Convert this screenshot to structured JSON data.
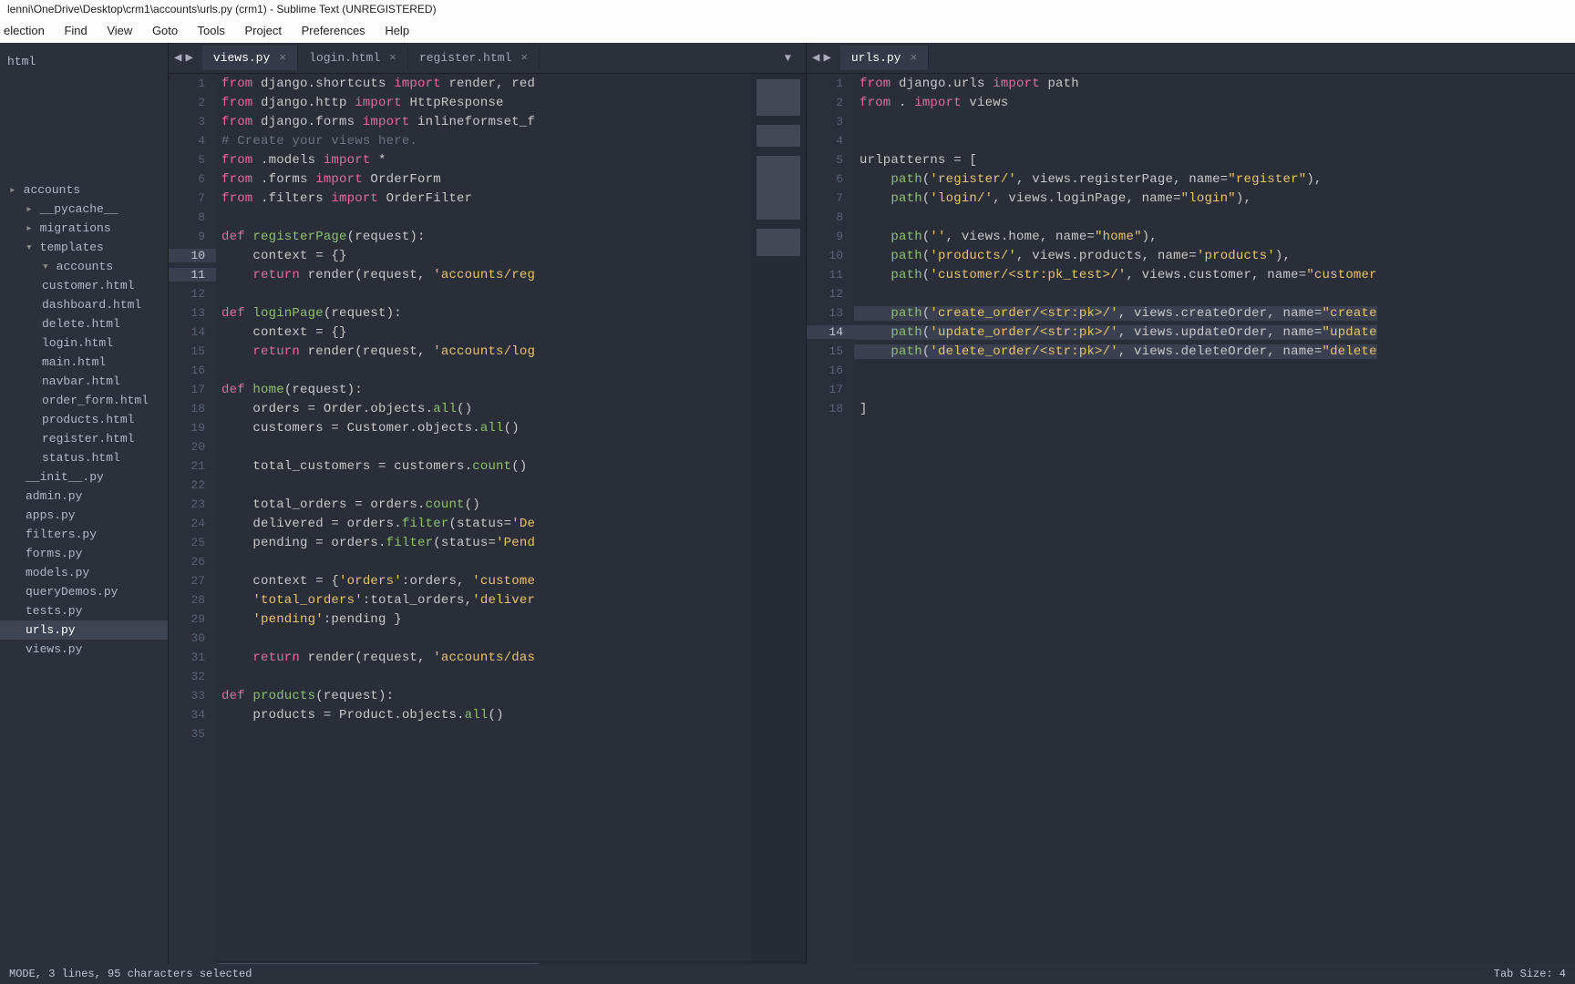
{
  "title": "lenni\\OneDrive\\Desktop\\crm1\\accounts\\urls.py (crm1) - Sublime Text (UNREGISTERED)",
  "menu": [
    "election",
    "Find",
    "View",
    "Goto",
    "Tools",
    "Project",
    "Preferences",
    "Help"
  ],
  "sidebar_top": "html",
  "sidebar": [
    {
      "label": "accounts",
      "cls": "folder"
    },
    {
      "label": "__pycache__",
      "cls": "folder indent1"
    },
    {
      "label": "migrations",
      "cls": "folder indent1"
    },
    {
      "label": "templates",
      "cls": "folder open indent1"
    },
    {
      "label": "accounts",
      "cls": "folder open indent2"
    },
    {
      "label": "customer.html",
      "cls": "item indent2"
    },
    {
      "label": "dashboard.html",
      "cls": "item indent2"
    },
    {
      "label": "delete.html",
      "cls": "item indent2"
    },
    {
      "label": "login.html",
      "cls": "item indent2"
    },
    {
      "label": "main.html",
      "cls": "item indent2"
    },
    {
      "label": "navbar.html",
      "cls": "item indent2"
    },
    {
      "label": "order_form.html",
      "cls": "item indent2"
    },
    {
      "label": "products.html",
      "cls": "item indent2"
    },
    {
      "label": "register.html",
      "cls": "item indent2"
    },
    {
      "label": "status.html",
      "cls": "item indent2"
    },
    {
      "label": "__init__.py",
      "cls": "item indent1"
    },
    {
      "label": "admin.py",
      "cls": "item indent1"
    },
    {
      "label": "apps.py",
      "cls": "item indent1"
    },
    {
      "label": "filters.py",
      "cls": "item indent1"
    },
    {
      "label": "forms.py",
      "cls": "item indent1"
    },
    {
      "label": "models.py",
      "cls": "item indent1"
    },
    {
      "label": "queryDemos.py",
      "cls": "item indent1"
    },
    {
      "label": "tests.py",
      "cls": "item indent1"
    },
    {
      "label": "urls.py",
      "cls": "item indent1 active"
    },
    {
      "label": "views.py",
      "cls": "item indent1"
    }
  ],
  "left_tabs": [
    {
      "label": "views.py",
      "active": true
    },
    {
      "label": "login.html",
      "active": false
    },
    {
      "label": "register.html",
      "active": false
    }
  ],
  "right_tabs": [
    {
      "label": "urls.py",
      "active": true
    }
  ],
  "status_left": "MODE, 3 lines, 95 characters selected",
  "status_right": "Tab Size: 4",
  "left_code": [
    {
      "n": 1,
      "t": [
        [
          "k",
          "from"
        ],
        [
          "n",
          " django.shortcuts "
        ],
        [
          "k",
          "import"
        ],
        [
          "n",
          " render, red"
        ]
      ]
    },
    {
      "n": 2,
      "t": [
        [
          "k",
          "from"
        ],
        [
          "n",
          " django.http "
        ],
        [
          "k",
          "import"
        ],
        [
          "n",
          " HttpResponse"
        ]
      ]
    },
    {
      "n": 3,
      "t": [
        [
          "k",
          "from"
        ],
        [
          "n",
          " django.forms "
        ],
        [
          "k",
          "import"
        ],
        [
          "n",
          " inlineformset_f"
        ]
      ]
    },
    {
      "n": 4,
      "t": [
        [
          "c",
          "# Create your views here."
        ]
      ]
    },
    {
      "n": 5,
      "t": [
        [
          "k",
          "from"
        ],
        [
          "n",
          " .models "
        ],
        [
          "k",
          "import"
        ],
        [
          "n",
          " *"
        ]
      ]
    },
    {
      "n": 6,
      "t": [
        [
          "k",
          "from"
        ],
        [
          "n",
          " .forms "
        ],
        [
          "k",
          "import"
        ],
        [
          "n",
          " OrderForm"
        ]
      ]
    },
    {
      "n": 7,
      "t": [
        [
          "k",
          "from"
        ],
        [
          "n",
          " .filters "
        ],
        [
          "k",
          "import"
        ],
        [
          "n",
          " OrderFilter"
        ]
      ]
    },
    {
      "n": 8,
      "t": []
    },
    {
      "n": 9,
      "t": [
        [
          "k",
          "def "
        ],
        [
          "fn",
          "registerPage"
        ],
        [
          "n",
          "(request):"
        ]
      ]
    },
    {
      "n": 10,
      "hl": true,
      "t": [
        [
          "n",
          "    context = {}"
        ]
      ]
    },
    {
      "n": 11,
      "hl": true,
      "t": [
        [
          "n",
          "    "
        ],
        [
          "k",
          "return"
        ],
        [
          "n",
          " render(request, "
        ],
        [
          "s",
          "'accounts/reg"
        ]
      ]
    },
    {
      "n": 12,
      "t": []
    },
    {
      "n": 13,
      "t": [
        [
          "k",
          "def "
        ],
        [
          "fn",
          "loginPage"
        ],
        [
          "n",
          "(request):"
        ]
      ]
    },
    {
      "n": 14,
      "t": [
        [
          "n",
          "    context = {}"
        ]
      ]
    },
    {
      "n": 15,
      "t": [
        [
          "n",
          "    "
        ],
        [
          "k",
          "return"
        ],
        [
          "n",
          " render(request, "
        ],
        [
          "s",
          "'accounts/log"
        ]
      ]
    },
    {
      "n": 16,
      "t": []
    },
    {
      "n": 17,
      "t": [
        [
          "k",
          "def "
        ],
        [
          "fn",
          "home"
        ],
        [
          "n",
          "(request):"
        ]
      ]
    },
    {
      "n": 18,
      "t": [
        [
          "n",
          "    orders = Order.objects."
        ],
        [
          "fn",
          "all"
        ],
        [
          "n",
          "()"
        ]
      ]
    },
    {
      "n": 19,
      "t": [
        [
          "n",
          "    customers = Customer.objects."
        ],
        [
          "fn",
          "all"
        ],
        [
          "n",
          "()"
        ]
      ]
    },
    {
      "n": 20,
      "t": []
    },
    {
      "n": 21,
      "t": [
        [
          "n",
          "    total_customers = customers."
        ],
        [
          "fn",
          "count"
        ],
        [
          "n",
          "()"
        ]
      ]
    },
    {
      "n": 22,
      "t": []
    },
    {
      "n": 23,
      "t": [
        [
          "n",
          "    total_orders = orders."
        ],
        [
          "fn",
          "count"
        ],
        [
          "n",
          "()"
        ]
      ]
    },
    {
      "n": 24,
      "t": [
        [
          "n",
          "    delivered = orders."
        ],
        [
          "fn",
          "filter"
        ],
        [
          "n",
          "("
        ],
        [
          "n",
          "status="
        ],
        [
          "s",
          "'De"
        ]
      ]
    },
    {
      "n": 25,
      "t": [
        [
          "n",
          "    pending = orders."
        ],
        [
          "fn",
          "filter"
        ],
        [
          "n",
          "("
        ],
        [
          "n",
          "status="
        ],
        [
          "s",
          "'Pend"
        ]
      ]
    },
    {
      "n": 26,
      "t": []
    },
    {
      "n": 27,
      "t": [
        [
          "n",
          "    context = {"
        ],
        [
          "s",
          "'orders'"
        ],
        [
          "n",
          ":orders, "
        ],
        [
          "s",
          "'custome"
        ]
      ]
    },
    {
      "n": 28,
      "t": [
        [
          "n",
          "    "
        ],
        [
          "s",
          "'total_orders'"
        ],
        [
          "n",
          ":total_orders,"
        ],
        [
          "s",
          "'deliver"
        ]
      ]
    },
    {
      "n": 29,
      "t": [
        [
          "n",
          "    "
        ],
        [
          "s",
          "'pending'"
        ],
        [
          "n",
          ":pending }"
        ]
      ]
    },
    {
      "n": 30,
      "t": []
    },
    {
      "n": 31,
      "t": [
        [
          "n",
          "    "
        ],
        [
          "k",
          "return"
        ],
        [
          "n",
          " render(request, "
        ],
        [
          "s",
          "'accounts/das"
        ]
      ]
    },
    {
      "n": 32,
      "t": []
    },
    {
      "n": 33,
      "t": [
        [
          "k",
          "def "
        ],
        [
          "fn",
          "products"
        ],
        [
          "n",
          "(request):"
        ]
      ]
    },
    {
      "n": 34,
      "t": [
        [
          "n",
          "    products = Product.objects."
        ],
        [
          "fn",
          "all"
        ],
        [
          "n",
          "()"
        ]
      ]
    },
    {
      "n": 35,
      "t": []
    }
  ],
  "right_code": [
    {
      "n": 1,
      "t": [
        [
          "k",
          "from"
        ],
        [
          "n",
          " django.urls "
        ],
        [
          "k",
          "import"
        ],
        [
          "n",
          " path"
        ]
      ]
    },
    {
      "n": 2,
      "t": [
        [
          "k",
          "from"
        ],
        [
          "n",
          " . "
        ],
        [
          "k",
          "import"
        ],
        [
          "n",
          " views"
        ]
      ]
    },
    {
      "n": 3,
      "t": []
    },
    {
      "n": 4,
      "t": []
    },
    {
      "n": 5,
      "t": [
        [
          "n",
          "urlpatterns = ["
        ]
      ]
    },
    {
      "n": 6,
      "t": [
        [
          "n",
          "    "
        ],
        [
          "fn",
          "path"
        ],
        [
          "n",
          "("
        ],
        [
          "s",
          "'register/'"
        ],
        [
          "n",
          ", views.registerPage, name="
        ],
        [
          "s",
          "\"register\""
        ],
        [
          "n",
          "),"
        ]
      ]
    },
    {
      "n": 7,
      "t": [
        [
          "n",
          "    "
        ],
        [
          "fn",
          "path"
        ],
        [
          "n",
          "("
        ],
        [
          "s",
          "'login/'"
        ],
        [
          "n",
          ", views.loginPage, name="
        ],
        [
          "s",
          "\"login\""
        ],
        [
          "n",
          "),"
        ]
      ]
    },
    {
      "n": 8,
      "t": []
    },
    {
      "n": 9,
      "t": [
        [
          "n",
          "    "
        ],
        [
          "fn",
          "path"
        ],
        [
          "n",
          "("
        ],
        [
          "s",
          "''"
        ],
        [
          "n",
          ", views.home, name="
        ],
        [
          "s",
          "\"home\""
        ],
        [
          "n",
          "),"
        ]
      ]
    },
    {
      "n": 10,
      "t": [
        [
          "n",
          "    "
        ],
        [
          "fn",
          "path"
        ],
        [
          "n",
          "("
        ],
        [
          "s",
          "'products/'"
        ],
        [
          "n",
          ", views.products, name="
        ],
        [
          "s",
          "'products'"
        ],
        [
          "n",
          "),"
        ]
      ]
    },
    {
      "n": 11,
      "t": [
        [
          "n",
          "    "
        ],
        [
          "fn",
          "path"
        ],
        [
          "n",
          "("
        ],
        [
          "s",
          "'customer/<str:pk_test>/'"
        ],
        [
          "n",
          ", views.customer, name="
        ],
        [
          "s",
          "\"customer"
        ]
      ]
    },
    {
      "n": 12,
      "t": []
    },
    {
      "n": 13,
      "sel": true,
      "t": [
        [
          "n",
          "    "
        ],
        [
          "fn",
          "path"
        ],
        [
          "n",
          "("
        ],
        [
          "s",
          "'create_order/<str:pk>/'"
        ],
        [
          "n",
          ", views.createOrder, name="
        ],
        [
          "s",
          "\"create"
        ]
      ]
    },
    {
      "n": 14,
      "sel": true,
      "hl": true,
      "t": [
        [
          "n",
          "    "
        ],
        [
          "fn",
          "path"
        ],
        [
          "n",
          "("
        ],
        [
          "s",
          "'update_order/<str:pk>/'"
        ],
        [
          "n",
          ", views.updateOrder, name="
        ],
        [
          "s",
          "\"update"
        ]
      ]
    },
    {
      "n": 15,
      "sel": true,
      "t": [
        [
          "n",
          "    "
        ],
        [
          "fn",
          "path"
        ],
        [
          "n",
          "("
        ],
        [
          "s",
          "'delete_order/<str:pk>/'"
        ],
        [
          "n",
          ", views.deleteOrder, name="
        ],
        [
          "s",
          "\"delete"
        ]
      ]
    },
    {
      "n": 16,
      "t": []
    },
    {
      "n": 17,
      "t": []
    },
    {
      "n": 18,
      "t": [
        [
          "n",
          "]"
        ]
      ]
    }
  ]
}
